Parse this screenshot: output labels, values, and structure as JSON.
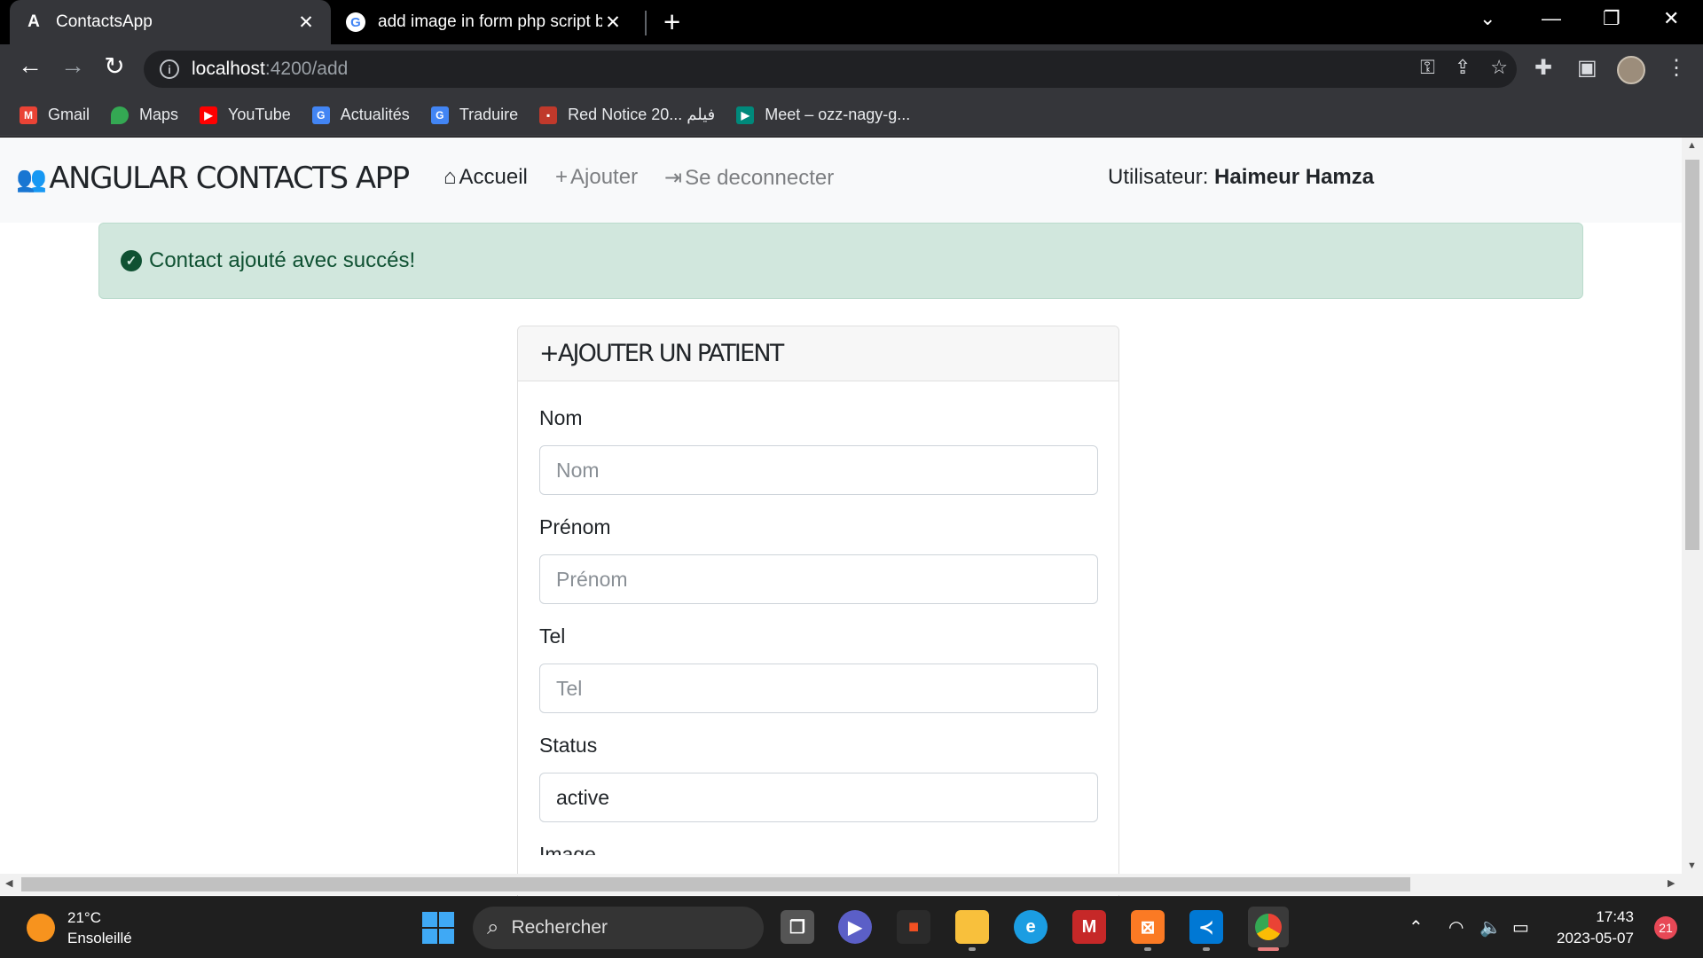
{
  "browser": {
    "tabs": [
      {
        "title": "ContactsApp",
        "favicon": "angular-icon",
        "active": true
      },
      {
        "title": "add image in form php script bac",
        "favicon": "google-icon",
        "active": false
      }
    ],
    "url_host": "localhost",
    "url_path": ":4200/add",
    "bookmarks": [
      {
        "label": "Gmail",
        "icon": "gmail-icon",
        "color": "#ea4335"
      },
      {
        "label": "Maps",
        "icon": "maps-icon",
        "color": "#34a853"
      },
      {
        "label": "YouTube",
        "icon": "youtube-icon",
        "color": "#ff0000"
      },
      {
        "label": "Actualités",
        "icon": "news-icon",
        "color": "#4285f4"
      },
      {
        "label": "Traduire",
        "icon": "translate-icon",
        "color": "#4285f4"
      },
      {
        "label": "Red Notice 20... فيلم",
        "icon": "movie-icon",
        "color": "#c0392b"
      },
      {
        "label": "Meet – ozz-nagy-g...",
        "icon": "meet-icon",
        "color": "#00897b"
      }
    ]
  },
  "app": {
    "brand": "ANGULAR CONTACTS APP",
    "nav": {
      "home": "Accueil",
      "add": "Ajouter",
      "logout": "Se deconnecter"
    },
    "user_label": "Utilisateur:",
    "user_name": "Haimeur Hamza",
    "alert": "Contact ajouté avec succés!",
    "card_title": "AJOUTER UN PATIENT",
    "form": {
      "nom_label": "Nom",
      "nom_placeholder": "Nom",
      "prenom_label": "Prénom",
      "prenom_placeholder": "Prénom",
      "tel_label": "Tel",
      "tel_placeholder": "Tel",
      "status_label": "Status",
      "status_value": "active",
      "image_label": "Image"
    }
  },
  "taskbar": {
    "temperature": "21°C",
    "weather": "Ensoleillé",
    "search_placeholder": "Rechercher",
    "time": "17:43",
    "date": "2023-05-07",
    "notifications": "21"
  },
  "colors": {
    "alert_bg": "#d1e7dd",
    "alert_text": "#0f5132",
    "navbar_bg": "#f8f9fa"
  }
}
